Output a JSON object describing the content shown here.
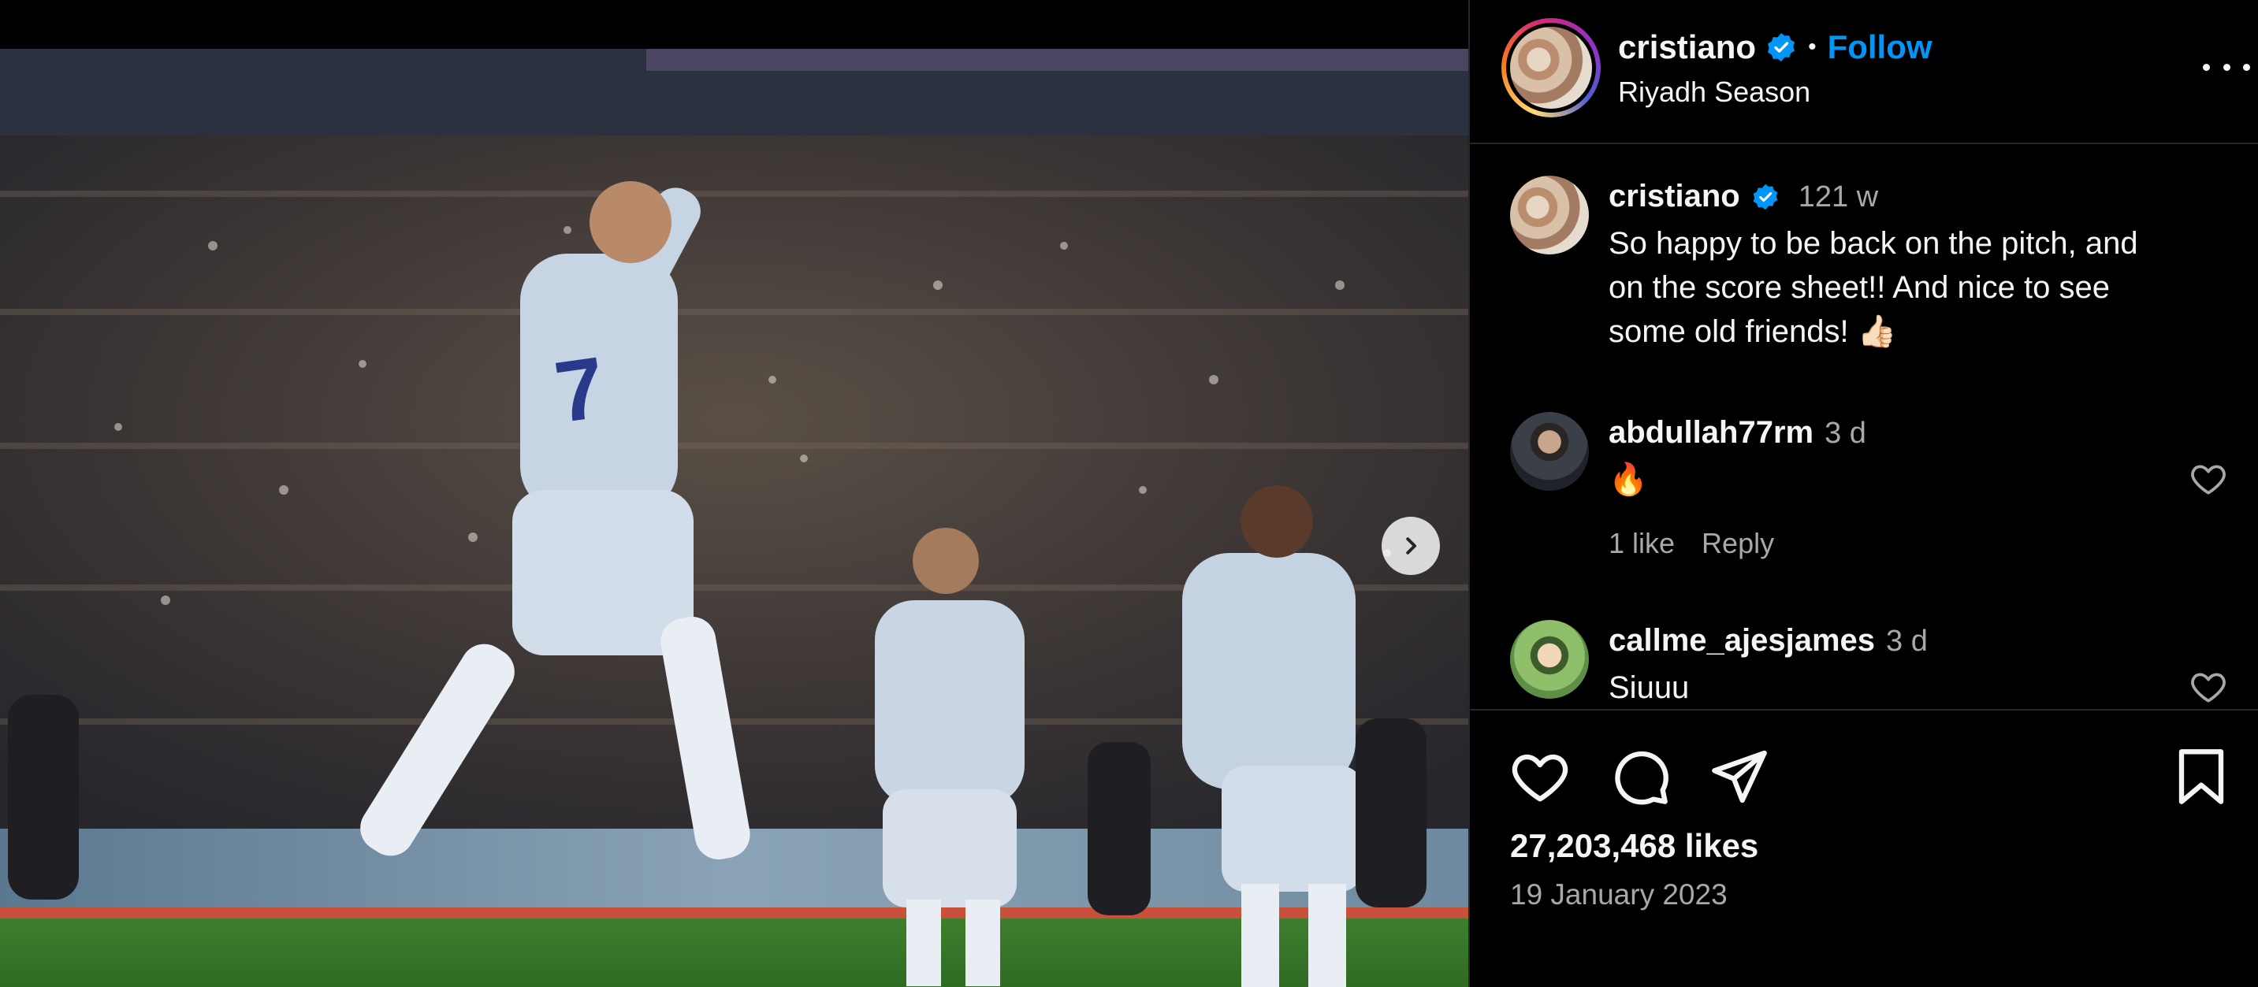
{
  "post": {
    "username": "cristiano",
    "verified": true,
    "follow_label": "Follow",
    "separator": "•",
    "location": "Riyadh Season",
    "more_icon": "more-horizontal-icon"
  },
  "caption": {
    "username": "cristiano",
    "time": "121 w",
    "text_line1": "So happy to be back on the pitch, and",
    "text_line2": "on the score sheet!! And nice to see",
    "text_line3": "some old friends! 👍🏻"
  },
  "comments": [
    {
      "username": "abdullah77rm",
      "time": "3 d",
      "text": "🔥",
      "likes": "1 like",
      "reply_label": "Reply"
    },
    {
      "username": "callme_ajesjames",
      "time": "3 d",
      "text": "Siuuu"
    }
  ],
  "actions": {
    "like_icon": "heart-icon",
    "comment_icon": "comment-icon",
    "share_icon": "send-icon",
    "save_icon": "bookmark-icon"
  },
  "stats": {
    "likes": "27,203,468 likes",
    "date": "19 January 2023"
  },
  "colors": {
    "accent": "#0095f6",
    "background": "#000000",
    "secondary_text": "#a8a8a8",
    "divider": "#262626"
  }
}
